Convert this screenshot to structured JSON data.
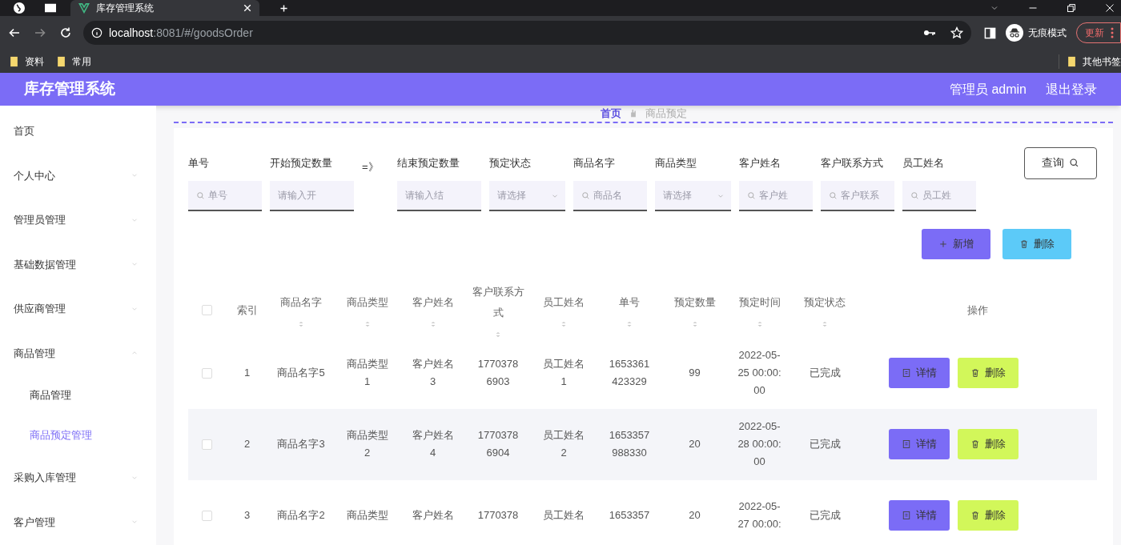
{
  "browser": {
    "tab_title": "库存管理系统",
    "url_host": "localhost",
    "url_path": ":8081/#/goodsOrder",
    "profile_label": "无痕模式",
    "update_button": "更新",
    "bookmarks": [
      "资料",
      "常用"
    ],
    "other_bookmarks": "其他书签"
  },
  "header": {
    "title": "库存管理系统",
    "user": "管理员 admin",
    "logout": "退出登录"
  },
  "sidebar": {
    "items": [
      {
        "label": "首页",
        "has_children": false,
        "selected": false
      },
      {
        "label": "个人中心",
        "has_children": true,
        "expanded": false,
        "selected": false
      },
      {
        "label": "管理员管理",
        "has_children": true,
        "expanded": false,
        "selected": false
      },
      {
        "label": "基础数据管理",
        "has_children": true,
        "expanded": false,
        "selected": false
      },
      {
        "label": "供应商管理",
        "has_children": true,
        "expanded": false,
        "selected": false
      },
      {
        "label": "商品管理",
        "has_children": true,
        "expanded": true,
        "selected": false,
        "children": [
          {
            "label": "商品管理",
            "selected": false
          },
          {
            "label": "商品预定管理",
            "selected": true
          }
        ]
      },
      {
        "label": "采购入库管理",
        "has_children": true,
        "expanded": false,
        "selected": false
      },
      {
        "label": "客户管理",
        "has_children": true,
        "expanded": false,
        "selected": false
      }
    ]
  },
  "breadcrumb": [
    "首页",
    "商品预定"
  ],
  "filters": [
    {
      "label": "单号",
      "kind": "search",
      "placeholder": "单号"
    },
    {
      "label": "开始预定数量",
      "kind": "plain",
      "placeholder": "请输入开"
    },
    {
      "label": "=》",
      "kind": "separator"
    },
    {
      "label": "结束预定数量",
      "kind": "plain",
      "placeholder": "请输入结"
    },
    {
      "label": "预定状态",
      "kind": "select",
      "placeholder": "请选择"
    },
    {
      "label": "商品名字",
      "kind": "search",
      "placeholder": "商品名"
    },
    {
      "label": "商品类型",
      "kind": "select",
      "placeholder": "请选择"
    },
    {
      "label": "客户姓名",
      "kind": "search",
      "placeholder": "客户姓"
    },
    {
      "label": "客户联系方式",
      "kind": "search",
      "placeholder": "客户联系"
    },
    {
      "label": "员工姓名",
      "kind": "search",
      "placeholder": "员工姓"
    }
  ],
  "query_button": "查询",
  "actions": [
    {
      "label": "新增",
      "kind": "add"
    },
    {
      "label": "删除",
      "kind": "delete"
    }
  ],
  "table": {
    "all_checked": false,
    "columns": [
      {
        "label": "索引",
        "sortable": false
      },
      {
        "label": "商品名字",
        "sortable": true
      },
      {
        "label": "商品类型",
        "sortable": true
      },
      {
        "label": "客户姓名",
        "sortable": true
      },
      {
        "label": "客户联系方式",
        "sortable": true
      },
      {
        "label": "员工姓名",
        "sortable": true
      },
      {
        "label": "单号",
        "sortable": true
      },
      {
        "label": "预定数量",
        "sortable": true
      },
      {
        "label": "预定时间",
        "sortable": true
      },
      {
        "label": "预定状态",
        "sortable": true
      },
      {
        "label": "操作",
        "sortable": false
      }
    ],
    "rows": [
      {
        "checked": false,
        "cells": [
          "1",
          "商品名字5",
          "商品类型\n1",
          "客户姓名\n3",
          "1770378\n6903",
          "员工姓名\n1",
          "1653361\n423329",
          "99",
          "2022-05-\n25 00:00:\n00",
          "已完成"
        ],
        "buttons": [
          "详情",
          "删除"
        ]
      },
      {
        "checked": false,
        "cells": [
          "2",
          "商品名字3",
          "商品类型\n2",
          "客户姓名\n4",
          "1770378\n6904",
          "员工姓名\n2",
          "1653357\n988330",
          "20",
          "2022-05-\n28 00:00:\n00",
          "已完成"
        ],
        "buttons": [
          "详情",
          "删除"
        ]
      },
      {
        "checked": false,
        "cells": [
          "3",
          "商品名字2",
          "商品类型",
          "客户姓名",
          "1770378",
          "员工姓名",
          "1653357",
          "20",
          "2022-05-\n27 00:00:",
          "已完成"
        ],
        "buttons": [
          "详情",
          "删除"
        ]
      }
    ]
  }
}
